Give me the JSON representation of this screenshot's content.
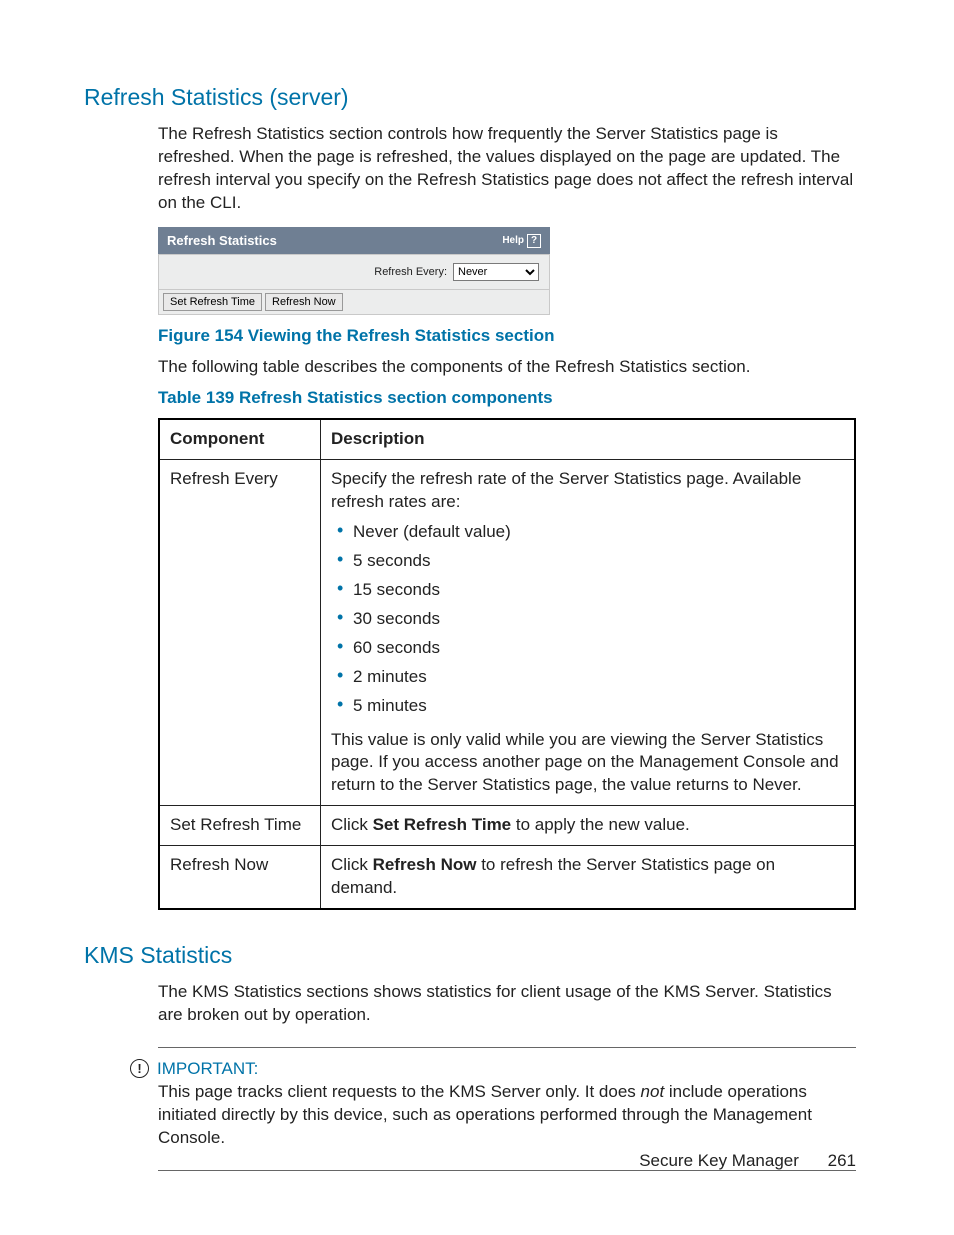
{
  "sections": {
    "refresh": {
      "heading": "Refresh Statistics (server)",
      "intro": "The Refresh Statistics section controls how frequently the Server Statistics page is refreshed. When the page is refreshed, the values displayed on the page are updated. The refresh interval you specify on the Refresh Statistics page does not affect the refresh interval on the CLI."
    },
    "kms": {
      "heading": "KMS Statistics",
      "intro": "The KMS Statistics sections shows statistics for client usage of the KMS Server. Statistics are broken out by operation."
    }
  },
  "widget": {
    "title": "Refresh Statistics",
    "help_label": "Help",
    "refresh_every_label": "Refresh Every:",
    "selected": "Never",
    "btn_set": "Set Refresh Time",
    "btn_now": "Refresh Now"
  },
  "figure_caption": "Figure 154 Viewing the Refresh Statistics section",
  "table_intro": "The following table describes the components of the Refresh Statistics section.",
  "table_caption": "Table 139 Refresh Statistics section components",
  "table": {
    "col1": "Component",
    "col2": "Description",
    "rows": {
      "r1_name": "Refresh Every",
      "r1_desc_lead": "Specify the refresh rate of the Server Statistics page. Available refresh rates are:",
      "r1_rates": {
        "a": "Never (default value)",
        "b": "5 seconds",
        "c": "15 seconds",
        "d": "30 seconds",
        "e": "60 seconds",
        "f": "2 minutes",
        "g": "5 minutes"
      },
      "r1_desc_tail": "This value is only valid while you are viewing the Server Statistics page. If you access another page on the Management Console and return to the Server Statistics page, the value returns to Never.",
      "r2_name": "Set Refresh Time",
      "r2_click": "Click ",
      "r2_bold": "Set Refresh Time",
      "r2_rest": " to apply the new value.",
      "r3_name": "Refresh Now",
      "r3_click": "Click ",
      "r3_bold": "Refresh Now",
      "r3_rest": " to refresh the Server Statistics page on demand."
    }
  },
  "callout": {
    "label": "IMPORTANT:",
    "text_a": "This page tracks client requests to the KMS Server only. It does ",
    "text_em": "not",
    "text_b": " include operations initiated directly by this device, such as operations performed through the Management Console."
  },
  "footer": {
    "doc": "Secure Key Manager",
    "page": "261"
  }
}
